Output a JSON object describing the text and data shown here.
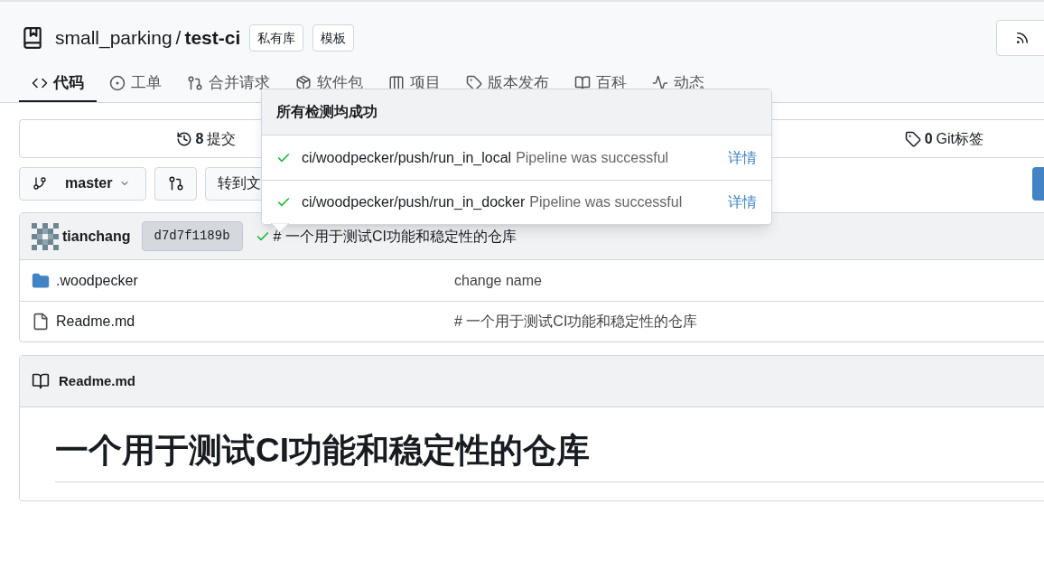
{
  "repo": {
    "owner": "small_parking",
    "separator": "/",
    "name": "test-ci",
    "badges": [
      "私有库",
      "模板"
    ]
  },
  "tabs": [
    {
      "kind": "code",
      "label": "代码",
      "selected": true
    },
    {
      "kind": "issue",
      "label": "工单",
      "selected": false
    },
    {
      "kind": "pull",
      "label": "合并请求",
      "selected": false
    },
    {
      "kind": "package",
      "label": "软件包",
      "selected": false
    },
    {
      "kind": "project",
      "label": "项目",
      "selected": false
    },
    {
      "kind": "tag",
      "label": "版本发布",
      "selected": false
    },
    {
      "kind": "book",
      "label": "百科",
      "selected": false
    },
    {
      "kind": "pulse",
      "label": "动态",
      "selected": false
    }
  ],
  "stats": [
    {
      "kind": "history",
      "count": "8",
      "label": "提交"
    },
    {
      "kind": "tag",
      "count": "0",
      "label": "Git标签"
    }
  ],
  "toolbar": {
    "branch": "master",
    "goto": "转到文"
  },
  "latest_commit": {
    "author": "tianchang",
    "sha": "d7d7f1189b",
    "message": "# 一个用于测试CI功能和稳定性的仓库",
    "passed": true
  },
  "files": [
    {
      "kind": "folder",
      "name": ".woodpecker",
      "message": "change name"
    },
    {
      "kind": "file",
      "name": "Readme.md",
      "message": "# 一个用于测试CI功能和稳定性的仓库"
    }
  ],
  "readme": {
    "filename": "Readme.md",
    "heading": "一个用于测试CI功能和稳定性的仓库"
  },
  "popup": {
    "title": "所有检测均成功",
    "checks": [
      {
        "passed": true,
        "context": "ci/woodpecker/push/run_in_local",
        "description": "Pipeline was successful",
        "link": "详情"
      },
      {
        "passed": true,
        "context": "ci/woodpecker/push/run_in_docker",
        "description": "Pipeline was successful",
        "link": "详情"
      }
    ]
  }
}
